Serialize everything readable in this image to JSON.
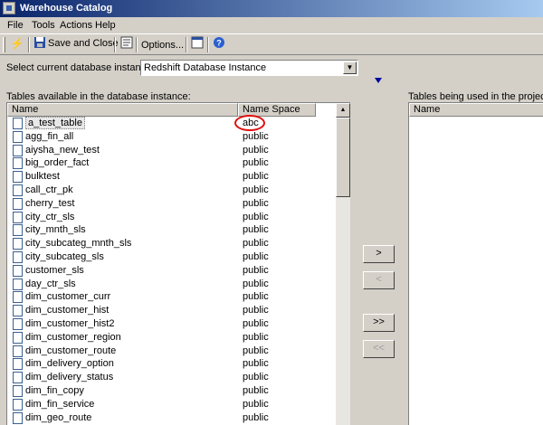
{
  "window": {
    "title": "Warehouse Catalog"
  },
  "menu": [
    "File",
    "Tools",
    "Actions",
    "Help"
  ],
  "toolbar": {
    "save_close_label": "Save and Close",
    "options_label": "Options...",
    "icons": [
      "lightning-icon",
      "save-icon",
      "sql-icon",
      "window-icon",
      "help-icon"
    ]
  },
  "db_instance": {
    "label": "Select current database instance",
    "value": "Redshift Database Instance"
  },
  "available": {
    "label": "Tables available in the database instance:",
    "col_name": "Name",
    "col_namespace": "Name Space",
    "rows": [
      {
        "name": "a_test_table",
        "ns": "abc"
      },
      {
        "name": "agg_fin_all",
        "ns": "public"
      },
      {
        "name": "aiysha_new_test",
        "ns": "public"
      },
      {
        "name": "big_order_fact",
        "ns": "public"
      },
      {
        "name": "bulktest",
        "ns": "public"
      },
      {
        "name": "call_ctr_pk",
        "ns": "public"
      },
      {
        "name": "cherry_test",
        "ns": "public"
      },
      {
        "name": "city_ctr_sls",
        "ns": "public"
      },
      {
        "name": "city_mnth_sls",
        "ns": "public"
      },
      {
        "name": "city_subcateg_mnth_sls",
        "ns": "public"
      },
      {
        "name": "city_subcateg_sls",
        "ns": "public"
      },
      {
        "name": "customer_sls",
        "ns": "public"
      },
      {
        "name": "day_ctr_sls",
        "ns": "public"
      },
      {
        "name": "dim_customer_curr",
        "ns": "public"
      },
      {
        "name": "dim_customer_hist",
        "ns": "public"
      },
      {
        "name": "dim_customer_hist2",
        "ns": "public"
      },
      {
        "name": "dim_customer_region",
        "ns": "public"
      },
      {
        "name": "dim_customer_route",
        "ns": "public"
      },
      {
        "name": "dim_delivery_option",
        "ns": "public"
      },
      {
        "name": "dim_delivery_status",
        "ns": "public"
      },
      {
        "name": "dim_fin_copy",
        "ns": "public"
      },
      {
        "name": "dim_fin_service",
        "ns": "public"
      },
      {
        "name": "dim_geo_route",
        "ns": "public"
      }
    ]
  },
  "used": {
    "label": "Tables being used in the project:",
    "col_name": "Name"
  },
  "move_buttons": {
    "add": ">",
    "remove": "<",
    "add_all": ">>",
    "remove_all": "<<"
  },
  "colors": {
    "title_start": "#0a246a",
    "title_end": "#a6caf0",
    "highlight_circle": "#e01010"
  }
}
